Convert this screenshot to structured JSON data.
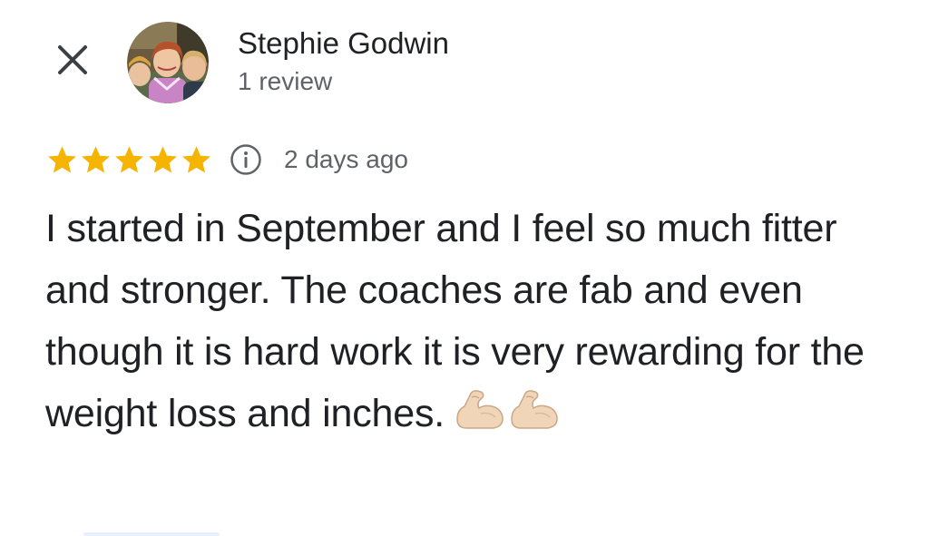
{
  "header": {
    "close_icon": "close-icon",
    "reviewer_name": "Stephie Godwin",
    "review_count": "1 review"
  },
  "rating": {
    "stars": 5,
    "max_stars": 5,
    "star_color": "#F5B400",
    "info_icon": "info-icon",
    "date": "2 days ago"
  },
  "review": {
    "text": "I started in September and I feel so much fitter and stronger. The coaches are fab and even though it is hard work it is very rewarding for the weight loss and inches.",
    "emoji": [
      "flexed-biceps",
      "flexed-biceps"
    ]
  },
  "colors": {
    "text_primary": "#202124",
    "text_secondary": "#5f6368",
    "background": "#ffffff"
  }
}
